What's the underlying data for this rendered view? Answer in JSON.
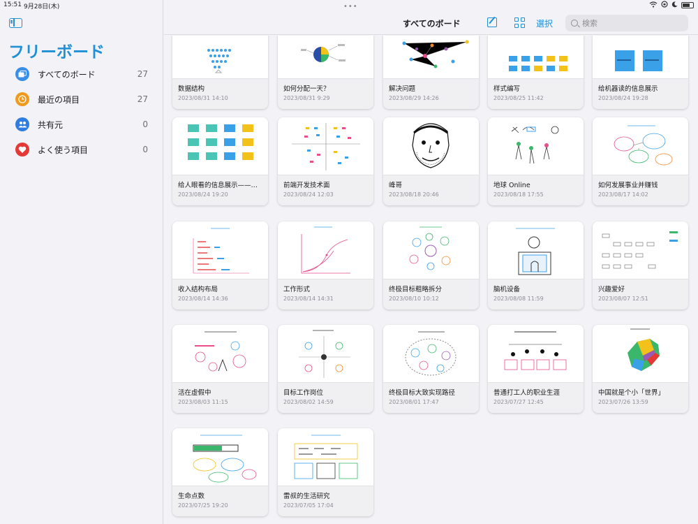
{
  "status_bar": {
    "time": "15:51",
    "date": "9月28日(木)"
  },
  "sidebar": {
    "toggle_icon": "sidebar-icon",
    "title": "フリーボード",
    "items": [
      {
        "label": "すべてのボード",
        "count": "27",
        "icon": "boards-icon",
        "color": "#3a8ee6"
      },
      {
        "label": "最近の項目",
        "count": "27",
        "icon": "clock-icon",
        "color": "#f09a1d"
      },
      {
        "label": "共有元",
        "count": "0",
        "icon": "people-icon",
        "color": "#2f7de1"
      },
      {
        "label": "よく使う項目",
        "count": "0",
        "icon": "heart-icon",
        "color": "#e53935"
      }
    ]
  },
  "header": {
    "title": "すべてのボード",
    "select_label": "選択",
    "search_placeholder": "検索"
  },
  "boards": [
    {
      "title": "数据结构",
      "date": "2023/08/31 14:10"
    },
    {
      "title": "如何分配一天？",
      "date": "2023/08/31 9:29"
    },
    {
      "title": "解决问题",
      "date": "2023/08/29 14:26"
    },
    {
      "title": "样式编写",
      "date": "2023/08/25 11:42"
    },
    {
      "title": "给机器读的信息展示",
      "date": "2023/08/24 19:28"
    },
    {
      "title": "给人眼看的信息展示——…",
      "date": "2023/08/24 19:20"
    },
    {
      "title": "前端开发技术面",
      "date": "2023/08/24 12:03"
    },
    {
      "title": "峰哥",
      "date": "2023/08/18 20:46"
    },
    {
      "title": "地球 Online",
      "date": "2023/08/18 17:55"
    },
    {
      "title": "如何发展事业并赚钱",
      "date": "2023/08/17 14:02"
    },
    {
      "title": "收入结构布局",
      "date": "2023/08/14 14:36"
    },
    {
      "title": "工作形式",
      "date": "2023/08/14 14:31"
    },
    {
      "title": "终极目标粗略拆分",
      "date": "2023/08/10 10:12"
    },
    {
      "title": "脑机设备",
      "date": "2023/08/08 11:59"
    },
    {
      "title": "兴趣爱好",
      "date": "2023/08/07 12:51"
    },
    {
      "title": "活在虚假中",
      "date": "2023/08/03 11:15"
    },
    {
      "title": "目标工作岗位",
      "date": "2023/08/02 14:59"
    },
    {
      "title": "终极目标大致实现路径",
      "date": "2023/08/01 17:47"
    },
    {
      "title": "普通打工人的职业生涯",
      "date": "2023/07/27 12:45"
    },
    {
      "title": "中国就是个小「世界」",
      "date": "2023/07/26 13:59"
    },
    {
      "title": "生命点数",
      "date": "2023/07/25 19:20"
    },
    {
      "title": "雷叔的生活研究",
      "date": "2023/07/05 17:04"
    }
  ]
}
